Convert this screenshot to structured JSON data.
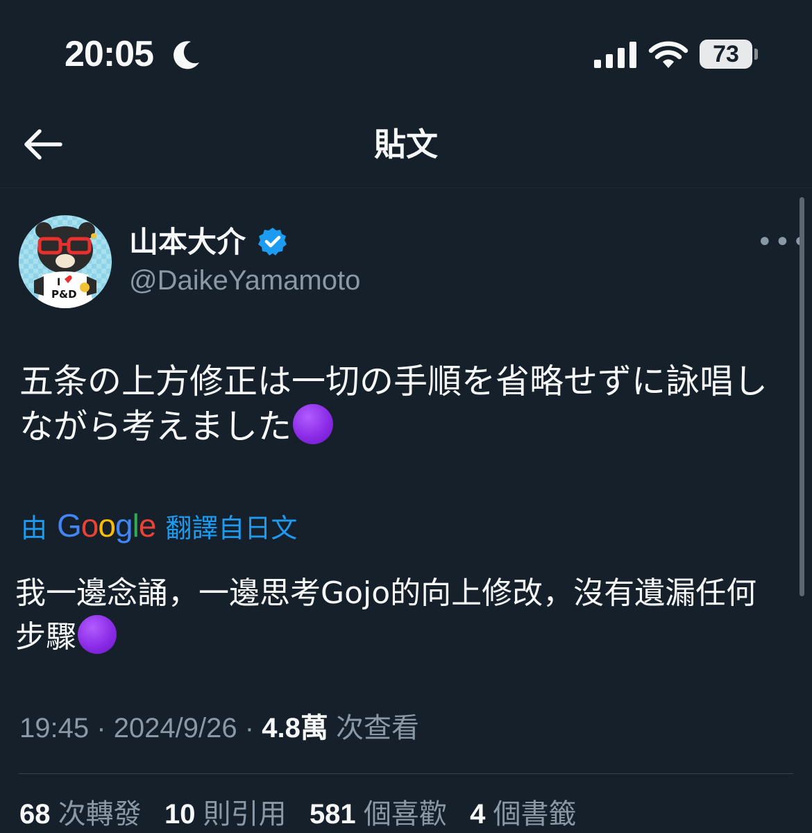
{
  "status_bar": {
    "time": "20:05",
    "battery": "73",
    "icons": [
      "moon-icon",
      "cellular-signal-icon",
      "wifi-icon",
      "battery-icon"
    ]
  },
  "header": {
    "title": "貼文",
    "back_icon": "arrow-left-icon"
  },
  "author": {
    "display_name": "山本大介",
    "handle": "@DaikeYamamoto",
    "verified": true,
    "verified_color": "#1d9bf0"
  },
  "tweet": {
    "text": "五条の上方修正は一切の手順を省略せずに詠唱しながら考えました",
    "emoji": "purple-circle"
  },
  "translation": {
    "prefix": "由",
    "provider": "Google",
    "suffix": "翻譯自日文",
    "text": "我一邊念誦，一邊思考Gojo的向上修改，沒有遺漏任何步驟",
    "link_color": "#1d9bf0"
  },
  "meta": {
    "time": "19:45",
    "separator": "·",
    "date": "2024/9/26",
    "views_count": "4.8萬",
    "views_label": "次查看"
  },
  "stats": {
    "retweets_count": "68",
    "retweets_label": "次轉發",
    "quotes_count": "10",
    "quotes_label": "則引用",
    "likes_count": "581",
    "likes_label": "個喜歡",
    "bookmarks_count": "4",
    "bookmarks_label": "個書籤"
  },
  "colors": {
    "background": "#15202b",
    "text_primary": "#f7f9f9",
    "text_secondary": "#8b98a5",
    "accent": "#1d9bf0"
  }
}
